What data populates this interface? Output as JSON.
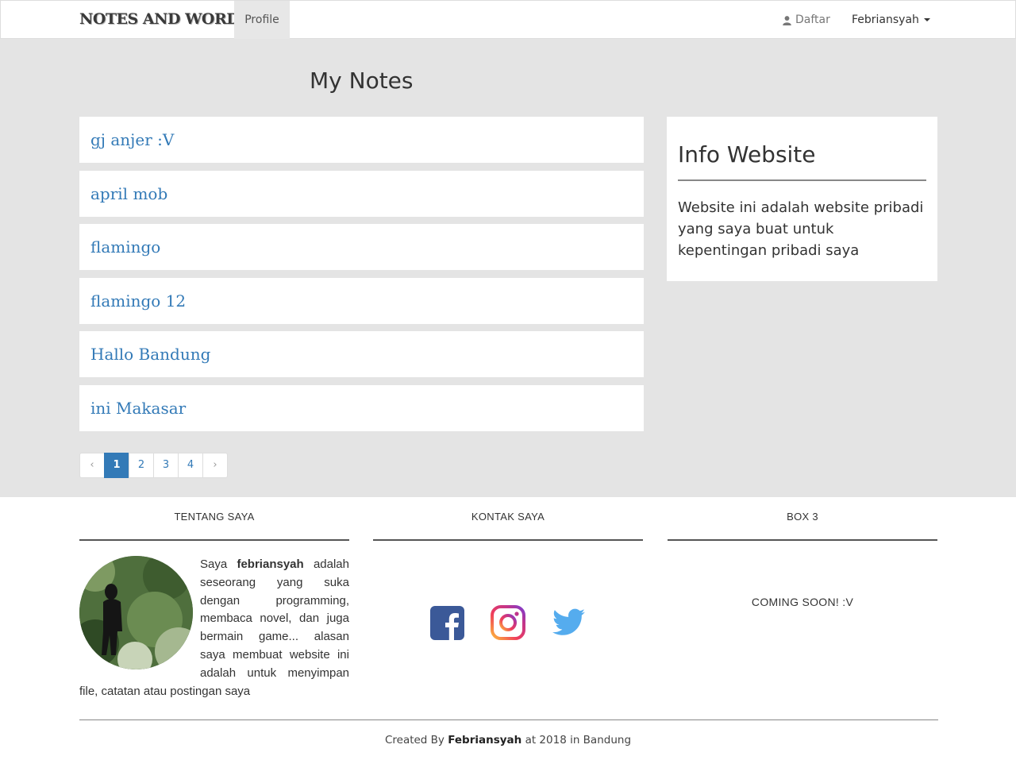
{
  "navbar": {
    "brand": "NOTES AND WORDS",
    "profile_label": "Profile",
    "daftar_label": "Daftar",
    "user_label": "Febriansyah"
  },
  "main": {
    "heading": "My Notes",
    "notes": [
      {
        "title": "gj anjer :V"
      },
      {
        "title": "april mob"
      },
      {
        "title": "flamingo"
      },
      {
        "title": "flamingo 12"
      },
      {
        "title": "Hallo Bandung"
      },
      {
        "title": "ini Makasar"
      }
    ],
    "pagination": {
      "prev": "‹",
      "pages": [
        "1",
        "2",
        "3",
        "4"
      ],
      "active": "1",
      "next": "›"
    }
  },
  "sidebar": {
    "title": "Info Website",
    "text": "Website ini adalah website pribadi yang saya buat untuk kepentingan pribadi saya"
  },
  "footer": {
    "about": {
      "heading": "TENTANG SAYA",
      "text_before": "Saya ",
      "name": "febriansyah",
      "text_after": " adalah seseorang yang suka dengan programming, membaca novel, dan juga bermain game... alasan saya membuat website ini adalah untuk menyimpan file, catatan atau postingan saya"
    },
    "contact": {
      "heading": "KONTAK SAYA",
      "icons": [
        "facebook-icon",
        "instagram-icon",
        "twitter-icon"
      ]
    },
    "box3": {
      "heading": "BOX 3",
      "text": "COMING SOON! :V"
    },
    "credits": {
      "prefix": "Created By ",
      "author": "Febriansyah",
      "suffix": " at 2018 in Bandung"
    }
  },
  "colors": {
    "link": "#337ab7",
    "background": "#e4e4e4",
    "facebook": "#3b5998",
    "twitter": "#55acee"
  }
}
